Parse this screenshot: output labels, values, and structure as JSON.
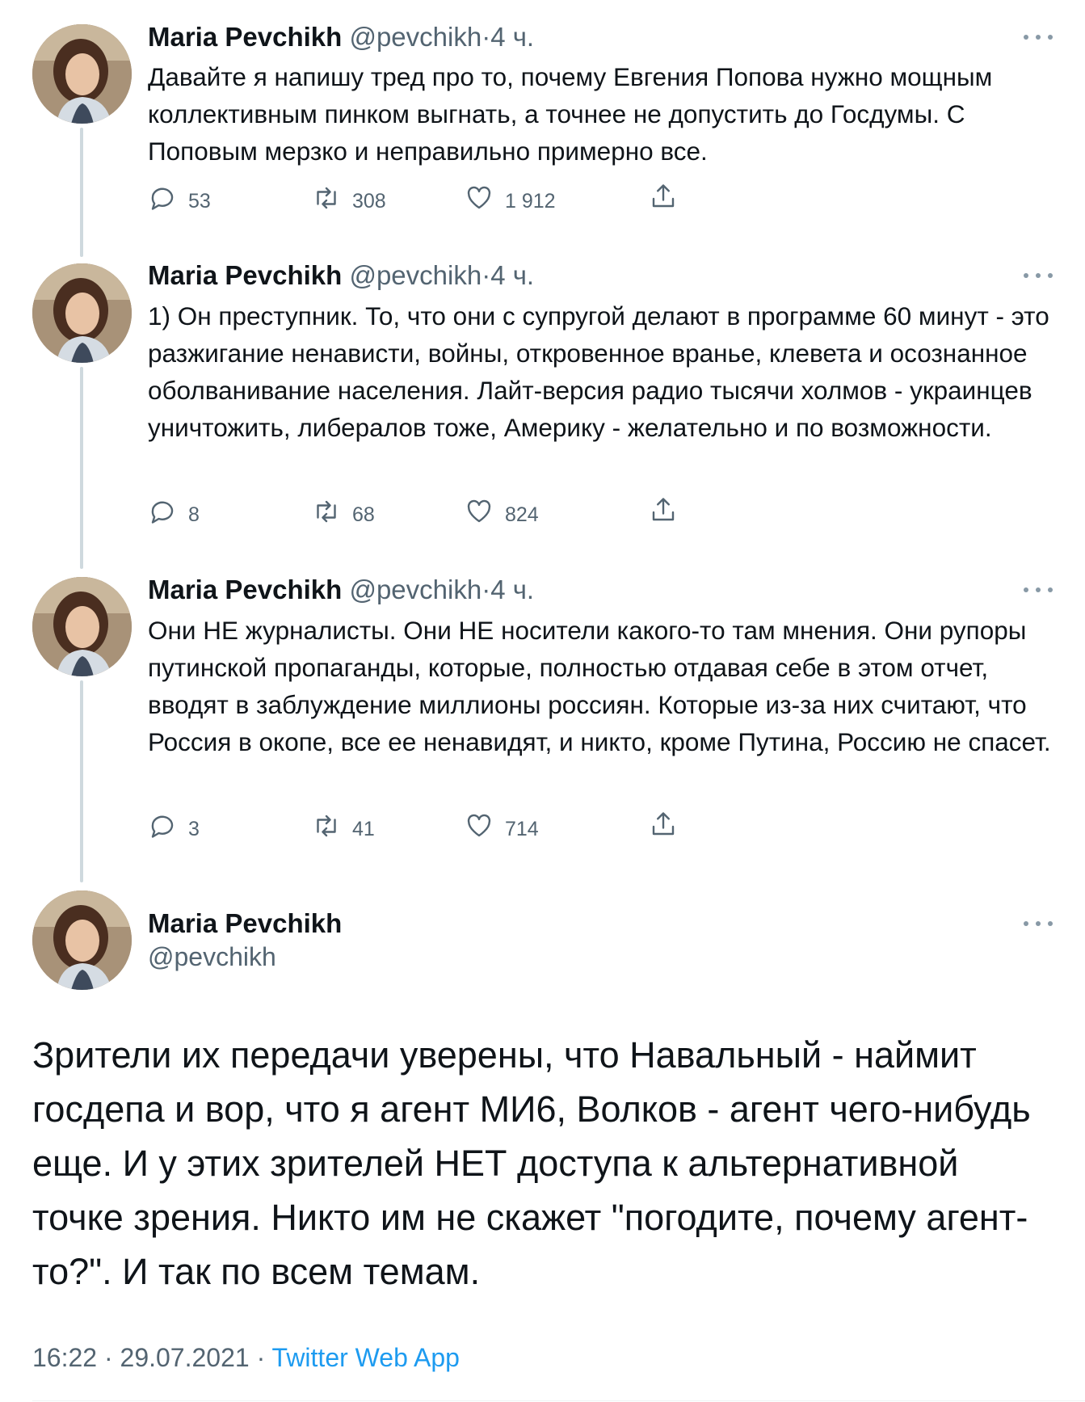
{
  "author": {
    "name": "Maria Pevchikh",
    "handle": "@pevchikh"
  },
  "colors": {
    "link": "#1d9bf0",
    "muted": "#536471",
    "thread_line": "#cfd9de"
  },
  "icons": {
    "reply": "comment-bubble",
    "retweet": "retweet-arrows",
    "like": "heart-outline",
    "share": "upload-arrow",
    "more": "three-dots"
  },
  "thread": [
    {
      "time": "4 ч.",
      "text": "Давайте я напишу тред про то, почему Евгения Попова нужно мощным коллективным пинком выгнать, а точнее не допустить до Госдумы. С Поповым мерзко и неправильно примерно все.",
      "replies": "53",
      "retweets": "308",
      "likes": "1 912"
    },
    {
      "time": "4 ч.",
      "text": "1) Он преступник. То, что они с супругой делают в программе 60 минут - это разжигание ненависти, войны, откровенное вранье, клевета и осознанное оболванивание населения. Лайт-версия радио тысячи холмов - украинцев уничтожить, либералов тоже, Америку - желательно и по возможности.",
      "replies": "8",
      "retweets": "68",
      "likes": "824"
    },
    {
      "time": "4 ч.",
      "text": "Они НЕ журналисты. Они НЕ носители какого-то там мнения. Они рупоры путинской пропаганды, которые, полностью отдавая себе в этом отчет, вводят в заблуждение миллионы россиян. Которые из-за них считают, что Россия в окопе, все ее ненавидят, и никто, кроме Путина, Россию не спасет.",
      "replies": "3",
      "retweets": "41",
      "likes": "714"
    }
  ],
  "main_tweet": {
    "text": "Зрители их передачи уверены, что Навальный - наймит госдепа и вор, что я агент МИ6, Волков - агент чего-нибудь еще. И у этих зрителей НЕТ доступа к альтернативной точке зрения. Никто им не скажет \"погодите, почему агент-то?\". И так по всем темам.",
    "time": "16:22",
    "date": "29.07.2021",
    "source": "Twitter Web App"
  },
  "separator": "·"
}
